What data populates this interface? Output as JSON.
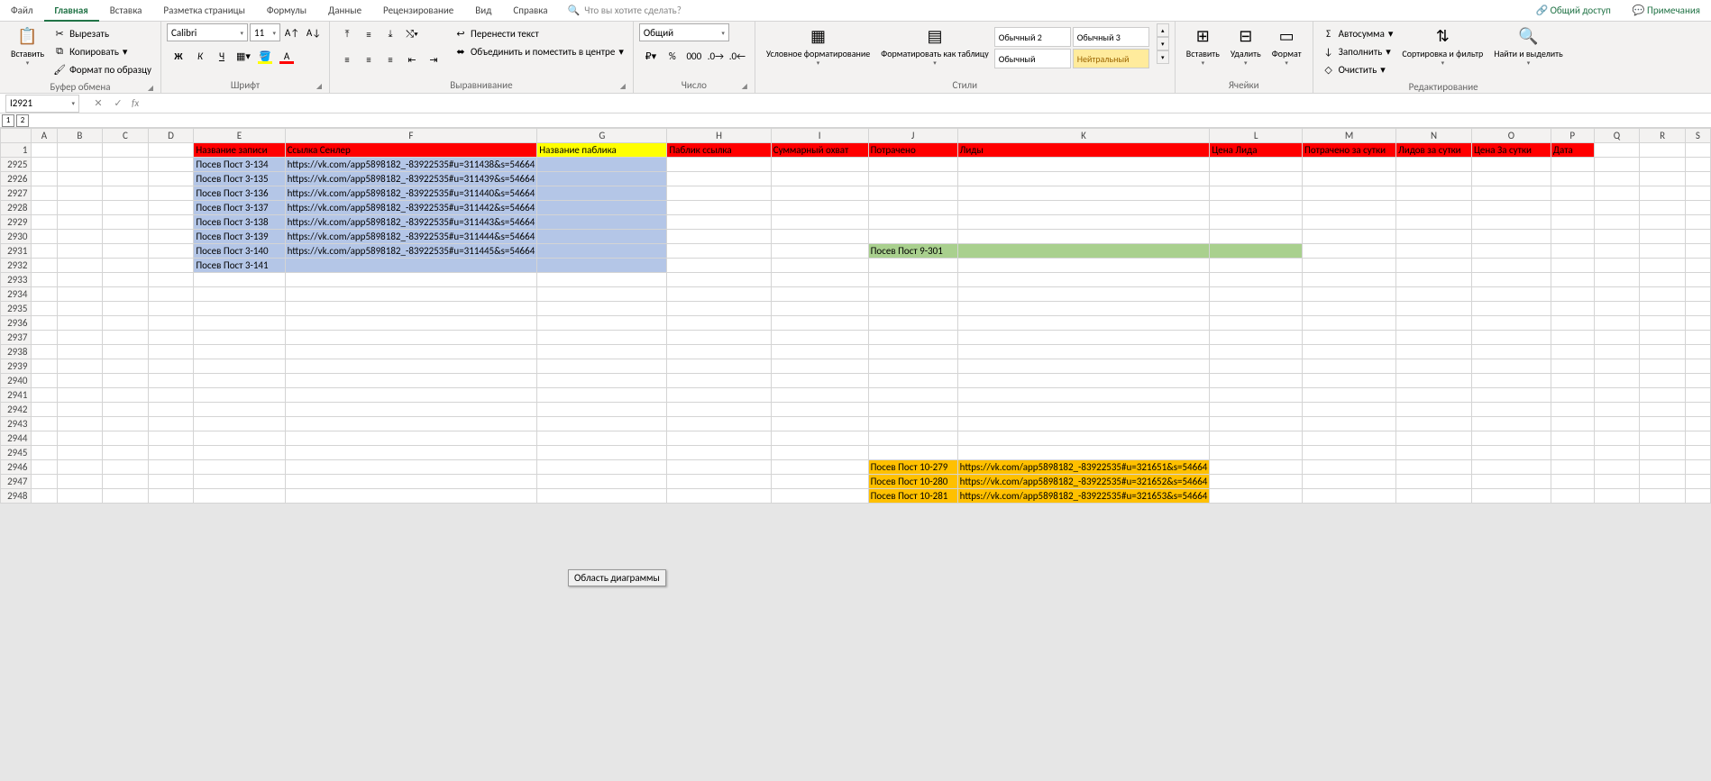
{
  "tabs": {
    "file": "Файл",
    "home": "Главная",
    "insert": "Вставка",
    "layout": "Разметка страницы",
    "formulas": "Формулы",
    "data": "Данные",
    "review": "Рецензирование",
    "view": "Вид",
    "help": "Справка",
    "tell_placeholder": "Что вы хотите сделать?",
    "share": "Общий доступ",
    "comments": "Примечания"
  },
  "ribbon": {
    "clipboard": {
      "label": "Буфер обмена",
      "paste": "Вставить",
      "cut": "Вырезать",
      "copy": "Копировать",
      "format_painter": "Формат по образцу"
    },
    "font": {
      "label": "Шрифт",
      "name": "Calibri",
      "size": "11"
    },
    "alignment": {
      "label": "Выравнивание",
      "wrap": "Перенести текст",
      "merge": "Объединить и поместить в центре"
    },
    "number": {
      "label": "Число",
      "format": "Общий"
    },
    "styles": {
      "label": "Стили",
      "cond": "Условное форматирование",
      "table": "Форматировать как таблицу",
      "s1": "Обычный 2",
      "s2": "Обычный 3",
      "s3": "Обычный",
      "s4": "Нейтральный"
    },
    "cells": {
      "label": "Ячейки",
      "insert": "Вставить",
      "delete": "Удалить",
      "format": "Формат"
    },
    "editing": {
      "label": "Редактирование",
      "autosum": "Автосумма",
      "fill": "Заполнить",
      "clear": "Очистить",
      "sort": "Сортировка и фильтр",
      "find": "Найти и выделить"
    }
  },
  "namebox": "I2921",
  "outline": [
    "1",
    "2"
  ],
  "columns": [
    "",
    "A",
    "B",
    "C",
    "D",
    "E",
    "F",
    "G",
    "H",
    "I",
    "J",
    "K",
    "L",
    "M",
    "N",
    "O",
    "P",
    "Q",
    "R",
    "S"
  ],
  "header_row": {
    "E": "Название записи",
    "F": "Ссылка Сенлер",
    "G": "Название паблика",
    "H": "Паблик ссылка",
    "I": "Суммарный охват",
    "J": "Потрачено",
    "K": "Лиды",
    "L": "Цена Лида",
    "M": "Потрачено за сутки",
    "N": "Лидов за сутки",
    "O": "Цена За сутки",
    "P": "Дата"
  },
  "row_numbers": [
    "1",
    "2925",
    "2926",
    "2927",
    "2928",
    "2929",
    "2930",
    "2931",
    "2932",
    "2933",
    "2934",
    "2935",
    "2936",
    "2937",
    "2938",
    "2939",
    "2940",
    "2941",
    "2942",
    "2943",
    "2944",
    "2945",
    "2946",
    "2947",
    "2948"
  ],
  "col_e_rows": {
    "2925": "Посев Пост 3-134",
    "2926": "Посев Пост 3-135",
    "2927": "Посев Пост 3-136",
    "2928": "Посев Пост 3-137",
    "2929": "Посев Пост 3-138",
    "2930": "Посев Пост 3-139",
    "2931": "Посев Пост 3-140",
    "2932": "Посев Пост 3-141"
  },
  "col_f_rows": {
    "2925": "https://vk.com/app5898182_-83922535#u=311438&s=54664",
    "2926": "https://vk.com/app5898182_-83922535#u=311439&s=54664",
    "2927": "https://vk.com/app5898182_-83922535#u=311440&s=54664",
    "2928": "https://vk.com/app5898182_-83922535#u=311442&s=54664",
    "2929": "https://vk.com/app5898182_-83922535#u=311443&s=54664",
    "2930": "https://vk.com/app5898182_-83922535#u=311444&s=54664",
    "2931": "https://vk.com/app5898182_-83922535#u=311445&s=54664"
  },
  "green_cell_j": "Посев Пост 9-301",
  "orange_rows": {
    "2946": {
      "J": "Посев Пост 10-279",
      "K": "https://vk.com/app5898182_-83922535#u=321651&s=54664"
    },
    "2947": {
      "J": "Посев Пост 10-280",
      "K": "https://vk.com/app5898182_-83922535#u=321652&s=54664"
    },
    "2948": {
      "J": "Посев Пост 10-281",
      "K": "https://vk.com/app5898182_-83922535#u=321653&s=54664"
    }
  },
  "chart_area_label": "Область диаграммы"
}
